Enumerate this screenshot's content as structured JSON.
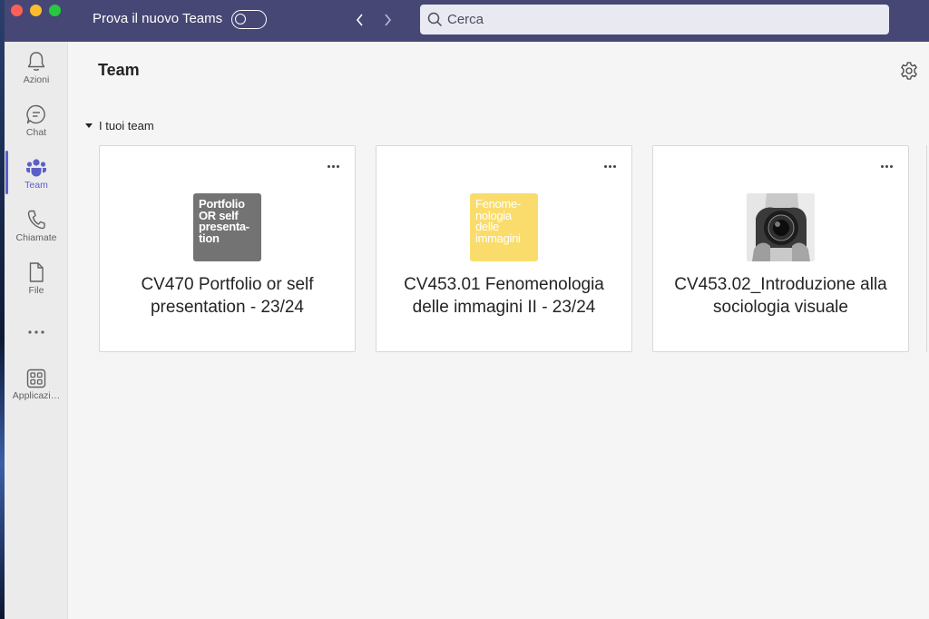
{
  "titlebar": {
    "try_new_label": "Prova il nuovo Teams",
    "toggle_on": false,
    "search_placeholder": "Cerca"
  },
  "rail": {
    "items": [
      {
        "label": "Azioni",
        "icon": "bell-icon"
      },
      {
        "label": "Chat",
        "icon": "chat-icon"
      },
      {
        "label": "Team",
        "icon": "teams-icon",
        "active": true
      },
      {
        "label": "Chiamate",
        "icon": "phone-icon"
      },
      {
        "label": "File",
        "icon": "file-icon"
      },
      {
        "label": "",
        "icon": "more-icon"
      },
      {
        "label": "Applicazi…",
        "icon": "apps-icon"
      }
    ]
  },
  "main": {
    "title": "Team",
    "section_label": "I tuoi team",
    "teams": [
      {
        "name": "CV470 Portfolio or self presentation - 23/24",
        "avatar_text": "Portfolio OR self presenta- tion",
        "avatar_color": "#737373"
      },
      {
        "name": "CV453.01 Fenomenologia delle immagini II - 23/24",
        "avatar_text": "Fenome- nologia delle immagini",
        "avatar_color": "#f9dc6c"
      },
      {
        "name": "CV453.02_Introduzione alla sociologia visuale",
        "avatar_text": "",
        "avatar_color": "#bdbdbd"
      }
    ]
  },
  "colors": {
    "titlebar": "#464775",
    "accent": "#5b5fc7"
  }
}
